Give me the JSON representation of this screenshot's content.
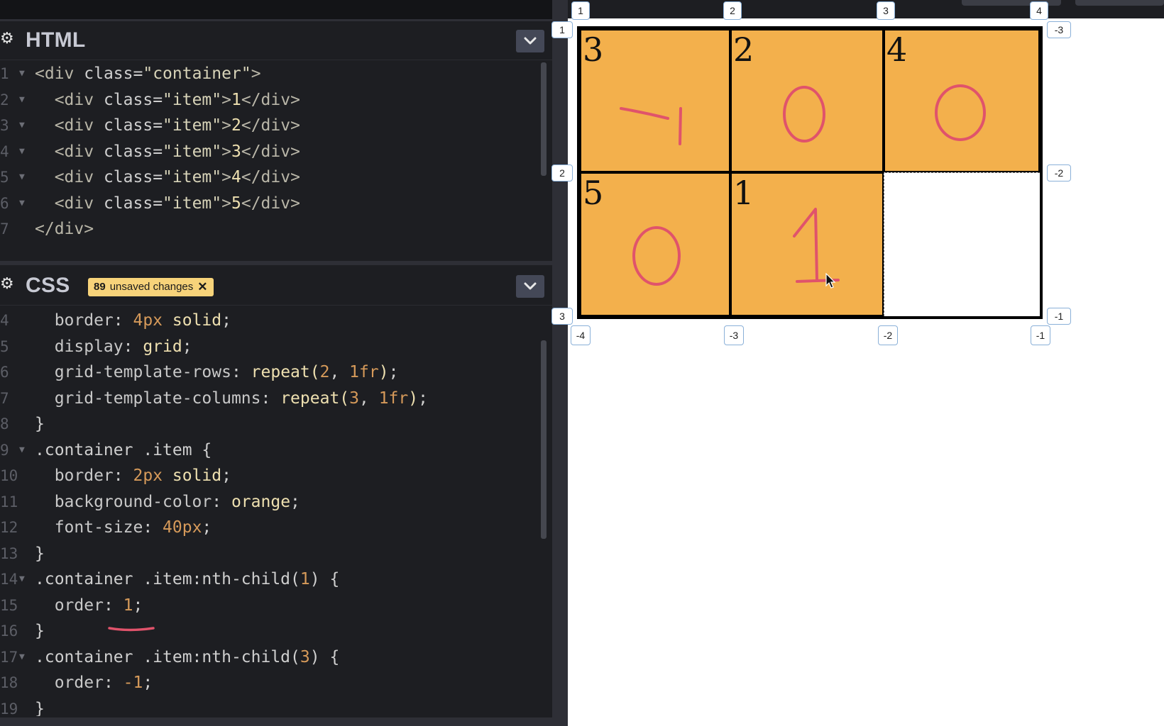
{
  "html_panel": {
    "title": "HTML",
    "lines": [
      {
        "n": "1",
        "fold": true,
        "parts": [
          [
            "t-tag",
            "<div "
          ],
          [
            "t-attr",
            "class"
          ],
          [
            "t-punc",
            "="
          ],
          [
            "t-str",
            "\"container\""
          ],
          [
            "t-tag",
            ">"
          ]
        ]
      },
      {
        "n": "2",
        "fold": true,
        "parts": [
          [
            "t-tag",
            "  <div "
          ],
          [
            "t-attr",
            "class"
          ],
          [
            "t-punc",
            "="
          ],
          [
            "t-str",
            "\"item\""
          ],
          [
            "t-tag",
            ">"
          ],
          [
            "t-val",
            "1"
          ],
          [
            "t-tag",
            "</div>"
          ]
        ]
      },
      {
        "n": "3",
        "fold": true,
        "parts": [
          [
            "t-tag",
            "  <div "
          ],
          [
            "t-attr",
            "class"
          ],
          [
            "t-punc",
            "="
          ],
          [
            "t-str",
            "\"item\""
          ],
          [
            "t-tag",
            ">"
          ],
          [
            "t-val",
            "2"
          ],
          [
            "t-tag",
            "</div>"
          ]
        ]
      },
      {
        "n": "4",
        "fold": true,
        "parts": [
          [
            "t-tag",
            "  <div "
          ],
          [
            "t-attr",
            "class"
          ],
          [
            "t-punc",
            "="
          ],
          [
            "t-str",
            "\"item\""
          ],
          [
            "t-tag",
            ">"
          ],
          [
            "t-val",
            "3"
          ],
          [
            "t-tag",
            "</div>"
          ]
        ]
      },
      {
        "n": "5",
        "fold": true,
        "parts": [
          [
            "t-tag",
            "  <div "
          ],
          [
            "t-attr",
            "class"
          ],
          [
            "t-punc",
            "="
          ],
          [
            "t-str",
            "\"item\""
          ],
          [
            "t-tag",
            ">"
          ],
          [
            "t-val",
            "4"
          ],
          [
            "t-tag",
            "</div>"
          ]
        ]
      },
      {
        "n": "6",
        "fold": true,
        "parts": [
          [
            "t-tag",
            "  <div "
          ],
          [
            "t-attr",
            "class"
          ],
          [
            "t-punc",
            "="
          ],
          [
            "t-str",
            "\"item\""
          ],
          [
            "t-tag",
            ">"
          ],
          [
            "t-val",
            "5"
          ],
          [
            "t-tag",
            "</div>"
          ]
        ]
      },
      {
        "n": "7",
        "fold": false,
        "parts": [
          [
            "t-tag",
            "</div>"
          ]
        ]
      }
    ]
  },
  "css_panel": {
    "title": "CSS",
    "badge_count": "89",
    "badge_text": "unsaved changes",
    "lines": [
      {
        "n": "4",
        "fold": false,
        "parts": [
          [
            "t-prop",
            "  border"
          ],
          [
            "t-punc",
            ": "
          ],
          [
            "t-num",
            "4px"
          ],
          [
            "t-val",
            " solid"
          ],
          [
            "t-punc",
            ";"
          ]
        ]
      },
      {
        "n": "5",
        "fold": false,
        "parts": [
          [
            "t-prop",
            "  display"
          ],
          [
            "t-punc",
            ": "
          ],
          [
            "t-val",
            "grid"
          ],
          [
            "t-punc",
            ";"
          ]
        ]
      },
      {
        "n": "6",
        "fold": false,
        "parts": [
          [
            "t-prop",
            "  grid-template-rows"
          ],
          [
            "t-punc",
            ": "
          ],
          [
            "t-val",
            "repeat("
          ],
          [
            "t-num",
            "2"
          ],
          [
            "t-punc",
            ", "
          ],
          [
            "t-num",
            "1fr"
          ],
          [
            "t-val",
            ")"
          ],
          [
            "t-punc",
            ";"
          ]
        ]
      },
      {
        "n": "7",
        "fold": false,
        "parts": [
          [
            "t-prop",
            "  grid-template-columns"
          ],
          [
            "t-punc",
            ": "
          ],
          [
            "t-val",
            "repeat("
          ],
          [
            "t-num",
            "3"
          ],
          [
            "t-punc",
            ", "
          ],
          [
            "t-num",
            "1fr"
          ],
          [
            "t-val",
            ")"
          ],
          [
            "t-punc",
            ";"
          ]
        ]
      },
      {
        "n": "8",
        "fold": false,
        "parts": [
          [
            "t-punc",
            "}"
          ]
        ]
      },
      {
        "n": "9",
        "fold": true,
        "parts": [
          [
            "t-sel",
            ".container .item "
          ],
          [
            "t-punc",
            "{"
          ]
        ]
      },
      {
        "n": "10",
        "fold": false,
        "parts": [
          [
            "t-prop",
            "  border"
          ],
          [
            "t-punc",
            ": "
          ],
          [
            "t-num",
            "2px"
          ],
          [
            "t-val",
            " solid"
          ],
          [
            "t-punc",
            ";"
          ]
        ]
      },
      {
        "n": "11",
        "fold": false,
        "parts": [
          [
            "t-prop",
            "  background-color"
          ],
          [
            "t-punc",
            ": "
          ],
          [
            "t-val",
            "orange"
          ],
          [
            "t-punc",
            ";"
          ]
        ]
      },
      {
        "n": "12",
        "fold": false,
        "parts": [
          [
            "t-prop",
            "  font-size"
          ],
          [
            "t-punc",
            ": "
          ],
          [
            "t-num",
            "40px"
          ],
          [
            "t-punc",
            ";"
          ]
        ]
      },
      {
        "n": "13",
        "fold": false,
        "parts": [
          [
            "t-punc",
            "}"
          ]
        ]
      },
      {
        "n": "14",
        "fold": true,
        "parts": [
          [
            "t-sel",
            ".container .item:nth-child("
          ],
          [
            "t-num",
            "1"
          ],
          [
            "t-sel",
            ") "
          ],
          [
            "t-punc",
            "{"
          ]
        ]
      },
      {
        "n": "15",
        "fold": false,
        "parts": [
          [
            "t-prop",
            "  order"
          ],
          [
            "t-punc",
            ": "
          ],
          [
            "t-num",
            "1"
          ],
          [
            "t-punc",
            ";"
          ]
        ]
      },
      {
        "n": "16",
        "fold": false,
        "parts": [
          [
            "t-punc",
            "}"
          ]
        ]
      },
      {
        "n": "17",
        "fold": true,
        "parts": [
          [
            "t-sel",
            ".container .item:nth-child("
          ],
          [
            "t-num",
            "3"
          ],
          [
            "t-sel",
            ") "
          ],
          [
            "t-punc",
            "{"
          ]
        ]
      },
      {
        "n": "18",
        "fold": false,
        "parts": [
          [
            "t-prop",
            "  order"
          ],
          [
            "t-punc",
            ": "
          ],
          [
            "t-num",
            "-1"
          ],
          [
            "t-punc",
            ";"
          ]
        ]
      },
      {
        "n": "19",
        "fold": false,
        "parts": [
          [
            "t-punc",
            "}"
          ]
        ]
      }
    ]
  },
  "preview": {
    "cells": [
      {
        "label": "3",
        "order": "-1"
      },
      {
        "label": "2",
        "order": "0"
      },
      {
        "label": "4",
        "order": "0"
      },
      {
        "label": "5",
        "order": "0"
      },
      {
        "label": "1",
        "order": "1"
      }
    ],
    "col_lines_top": [
      "1",
      "2",
      "3",
      "4"
    ],
    "col_lines_bottom": [
      "-4",
      "-3",
      "-2",
      "-1"
    ],
    "row_lines_left": [
      "1",
      "2",
      "3"
    ],
    "row_lines_right": [
      "-3",
      "-2",
      "-1"
    ],
    "colors": {
      "item_bg": "#f3b04c",
      "annotation": "#e0536b",
      "badge": "#f7d37a"
    }
  }
}
